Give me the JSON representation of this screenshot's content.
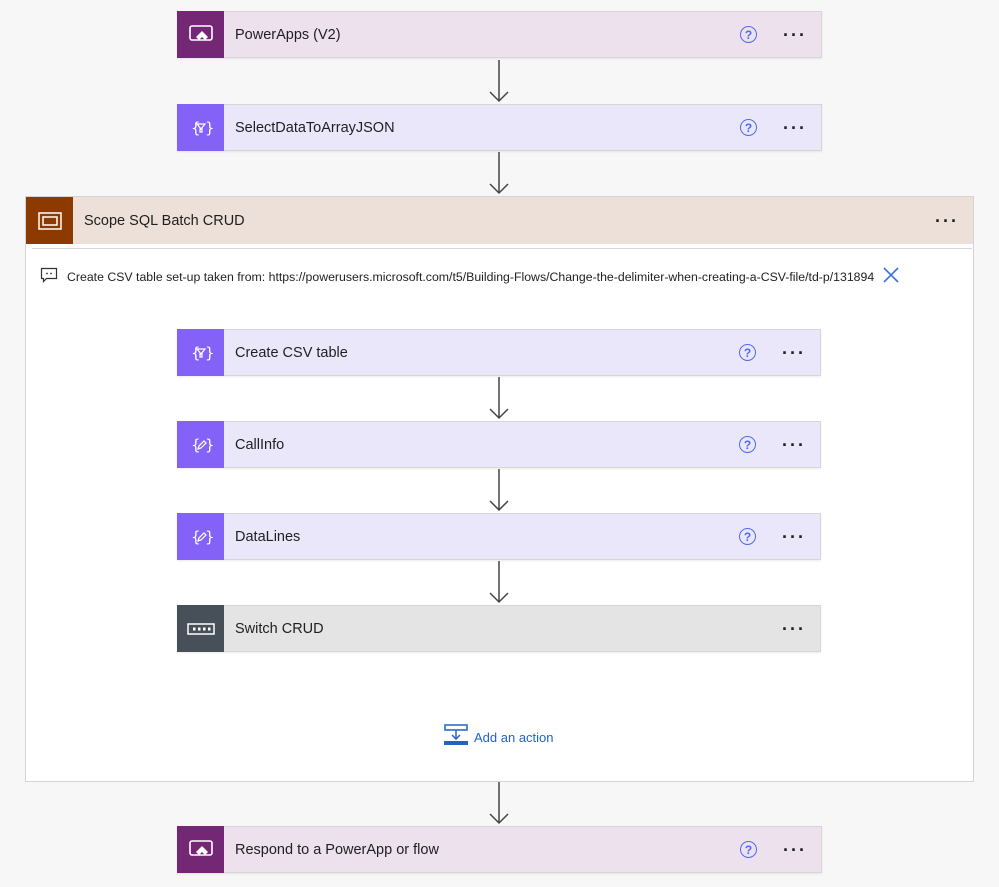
{
  "steps": {
    "trigger": {
      "title": "PowerApps (V2)",
      "icon": "powerapps-icon"
    },
    "select": {
      "title": "SelectDataToArrayJSON",
      "icon": "data-operation-icon"
    },
    "respond": {
      "title": "Respond to a PowerApp or flow",
      "icon": "powerapps-icon"
    }
  },
  "scope": {
    "title": "Scope SQL Batch CRUD",
    "icon": "scope-icon",
    "comment": "Create CSV table set-up taken from: https://powerusers.microsoft.com/t5/Building-Flows/Change-the-delimiter-when-creating-a-CSV-file/td-p/131894",
    "actions": [
      {
        "title": "Create CSV table",
        "icon": "data-operation-icon"
      },
      {
        "title": "CallInfo",
        "icon": "variable-icon"
      },
      {
        "title": "DataLines",
        "icon": "variable-icon"
      },
      {
        "title": "Switch CRUD",
        "icon": "switch-icon"
      }
    ],
    "add_action_label": "Add an action"
  },
  "common": {
    "help_glyph": "?",
    "more_glyph": "···"
  },
  "colors": {
    "powerapps": "#742774",
    "variable": "#8462f7",
    "switch": "#474f59",
    "scope": "#8c3a00",
    "link": "#1f63c8",
    "help": "#4f6bed"
  }
}
